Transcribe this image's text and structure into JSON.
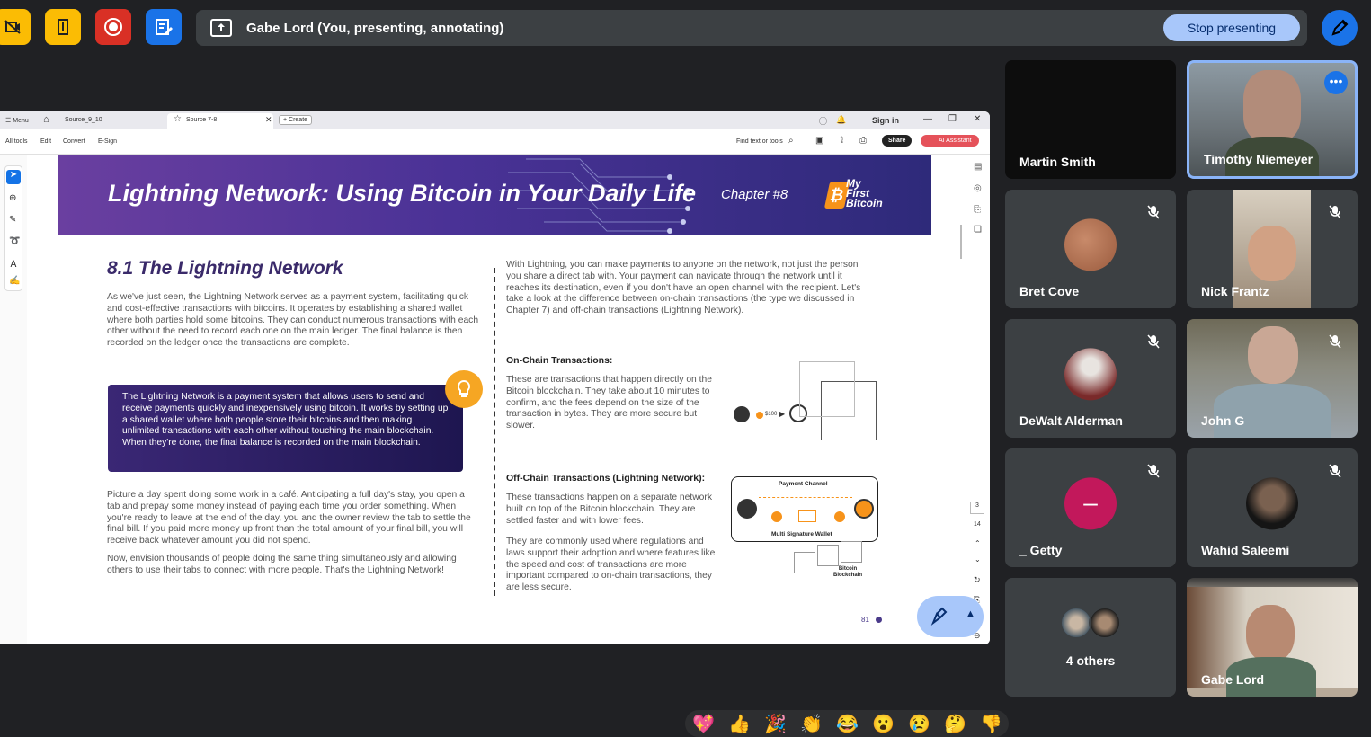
{
  "banner": {
    "text": "Gabe Lord (You, presenting, annotating)",
    "stop_label": "Stop presenting"
  },
  "browser": {
    "menu": "Menu",
    "tab1": "Source_9_10",
    "tab2": "Source 7-8",
    "new_tab": "+ Create",
    "sign_in": "Sign in",
    "tools": [
      "All tools",
      "Edit",
      "Convert",
      "E-Sign"
    ],
    "find": "Find text or tools",
    "share": "Share",
    "ai": "AI Assistant"
  },
  "doc": {
    "title": "Lightning Network: Using Bitcoin in Your Daily Life",
    "chapter": "Chapter #8",
    "logo": [
      "My",
      "First",
      "Bitcoin"
    ],
    "heading": "8.1 The Lightning Network",
    "para1": "As we've just seen, the Lightning Network serves as a payment system, facilitating quick and cost-effective transactions with bitcoins. It operates by establishing a shared wallet where both parties hold some bitcoins. They can conduct numerous transactions with each other without the need to record each one on the main ledger. The final balance is then recorded on the ledger once the transactions are complete.",
    "callout": "The Lightning Network is a payment system that allows users to send and receive payments quickly and inexpensively using bitcoin. It works by setting up a shared wallet where both people store their bitcoins and then making unlimited transactions with each other without touching the main blockchain. When they're done, the final balance is recorded on the main blockchain.",
    "para2": "Picture a day spent doing some work in a café. Anticipating a full day's stay, you open a tab and prepay some money instead of paying each time you order something. When you're ready to leave at the end of the day, you and the owner review the tab to settle the final bill. If you paid more money up front than the total amount of your final bill, you will receive back whatever amount you did not spend.",
    "para3": "Now, envision thousands of people doing the same thing simultaneously and allowing others to use their tabs to connect with more people. That's the Lightning Network!",
    "right1": "With Lightning, you can make payments to anyone on the network, not just the person you share a direct tab with. Your payment can navigate through the network until it reaches its destination, even if you don't have an open channel with the recipient. Let's take a look at the difference between on-chain transactions (the type we discussed in Chapter 7) and off-chain transactions (Lightning Network).",
    "onchain_h": "On-Chain Transactions:",
    "onchain": "These are transactions that happen directly on the Bitcoin blockchain. They take about 10 minutes to confirm, and the fees depend on the size of the transaction in bytes. They are more secure but slower.",
    "offchain_h": "Off-Chain Transactions (Lightning Network):",
    "offchain1": "These transactions happen on a separate network built on top of the Bitcoin blockchain. They are settled faster and with lower fees.",
    "offchain2": "They are commonly used where regulations and laws support their adoption and where features like the speed and cost of transactions are more important compared to on-chain transactions, they are less secure.",
    "diagram_price": "$100",
    "payment_channel": "Payment Channel",
    "multisig": "Multi Signature Wallet",
    "blockchain": "Bitcoin Blockchain",
    "page_num": "81",
    "page_box": "3",
    "page_total": "14"
  },
  "participants": [
    {
      "name": "Martin Smith"
    },
    {
      "name": "Timothy Niemeyer"
    },
    {
      "name": "Bret Cove"
    },
    {
      "name": "Nick Frantz"
    },
    {
      "name": "DeWalt Alderman"
    },
    {
      "name": "John G"
    },
    {
      "name": "_ Getty",
      "initial": "–",
      "color": "#c2185b"
    },
    {
      "name": "Wahid Saleemi"
    },
    {
      "name": "4 others"
    },
    {
      "name": "Gabe Lord"
    }
  ],
  "reactions": [
    "💖",
    "👍",
    "🎉",
    "👏",
    "😂",
    "😮",
    "😢",
    "🤔",
    "👎"
  ]
}
